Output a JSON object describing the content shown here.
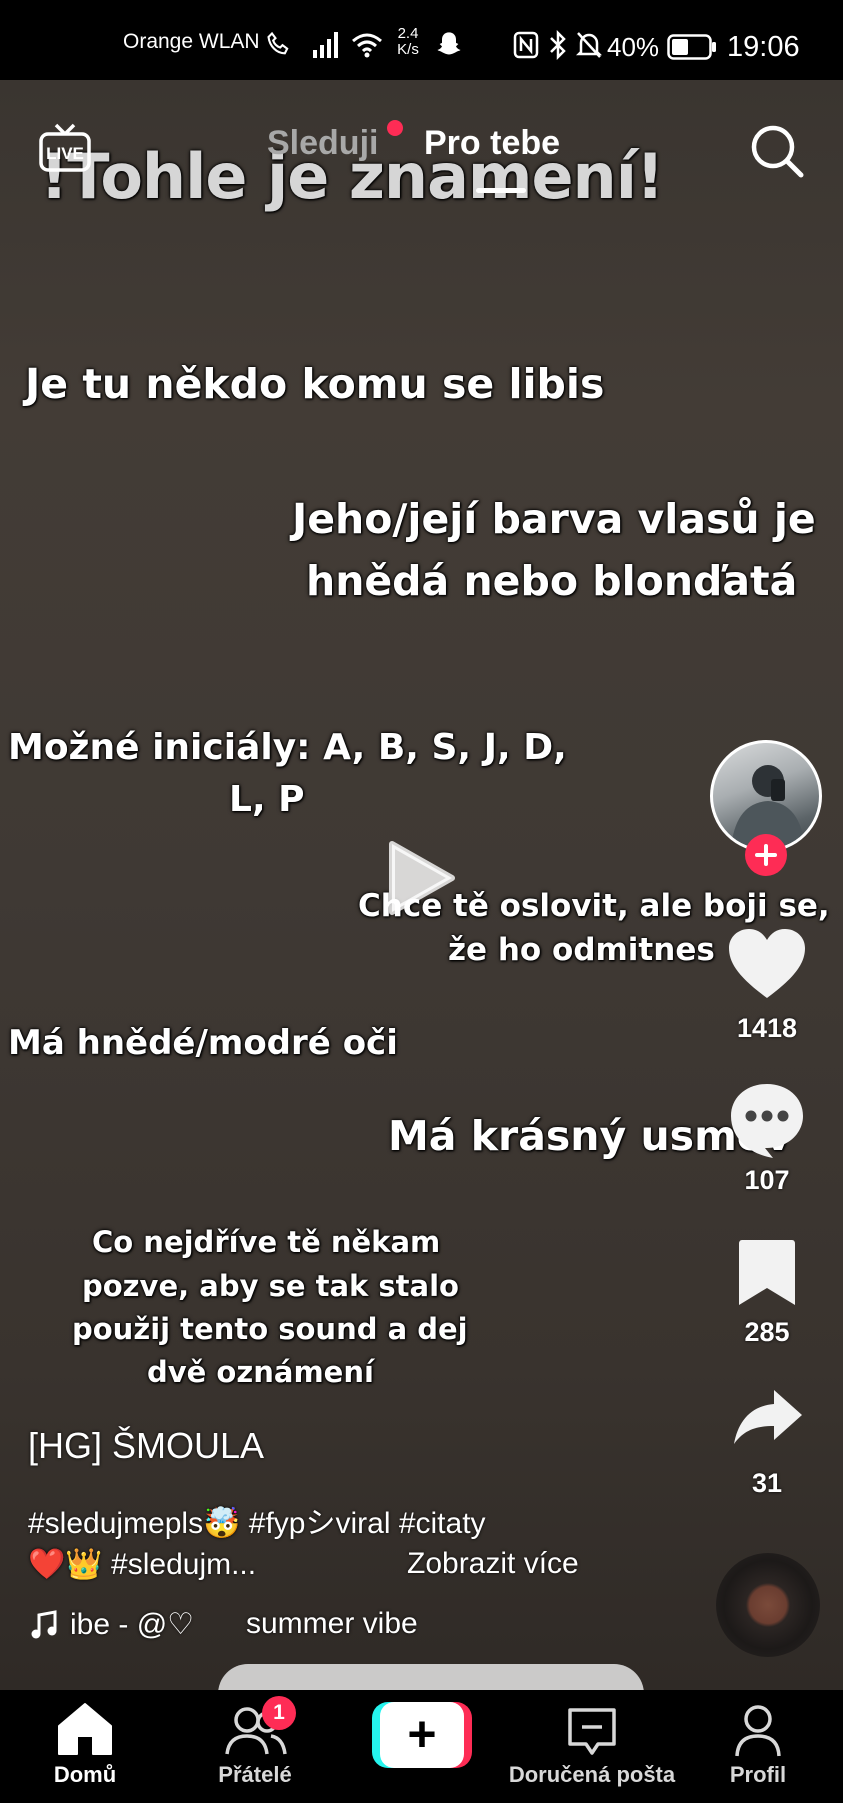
{
  "status_bar": {
    "carrier": "Orange WLAN",
    "speed_value": "2.4",
    "speed_unit": "K/s",
    "battery": "40%",
    "time": "19:06",
    "icons": [
      "phone-icon",
      "signal-icon",
      "wifi-icon",
      "snapchat-icon",
      "nfc-icon",
      "bluetooth-icon",
      "mute-icon",
      "battery-icon"
    ]
  },
  "top_nav": {
    "live": "LIVE",
    "following": "Sleduji",
    "for_you": "Pro tebe"
  },
  "video": {
    "title": "!Tohle je znamení!",
    "lines": [
      "Je tu někdo komu se libis",
      "Jeho/její barva vlasů je",
      "hnědá nebo blonďatá",
      "Možné iniciály: A, B, S, J, D,",
      "L, P",
      "Chce tě oslovit, ale boji se,",
      "že ho odmitnes",
      "Má hnědé/modré oči",
      "Má krásný usmev",
      "Co nejdříve tě někam",
      "pozve, aby se tak stalo",
      "použij tento sound a dej",
      "dvě oznámení"
    ]
  },
  "actions": {
    "likes": "1418",
    "comments": "107",
    "saves": "285",
    "shares": "31"
  },
  "caption": {
    "username": "[HG] ŠMOULA",
    "line1": "#sledujmepls🤯 #fypシviral #citaty",
    "line2": "❤️👑 #sledujm...",
    "more": "Zobrazit více",
    "sound_a": "ibe - @♡",
    "sound_b": "summer vibe"
  },
  "bottom_nav": {
    "home": "Domů",
    "friends": "Přátelé",
    "friends_badge": "1",
    "create": "+",
    "inbox": "Doručená pošta",
    "profile": "Profil"
  },
  "colors": {
    "accent_red": "#fe2c55",
    "accent_cyan": "#25f4ee"
  }
}
